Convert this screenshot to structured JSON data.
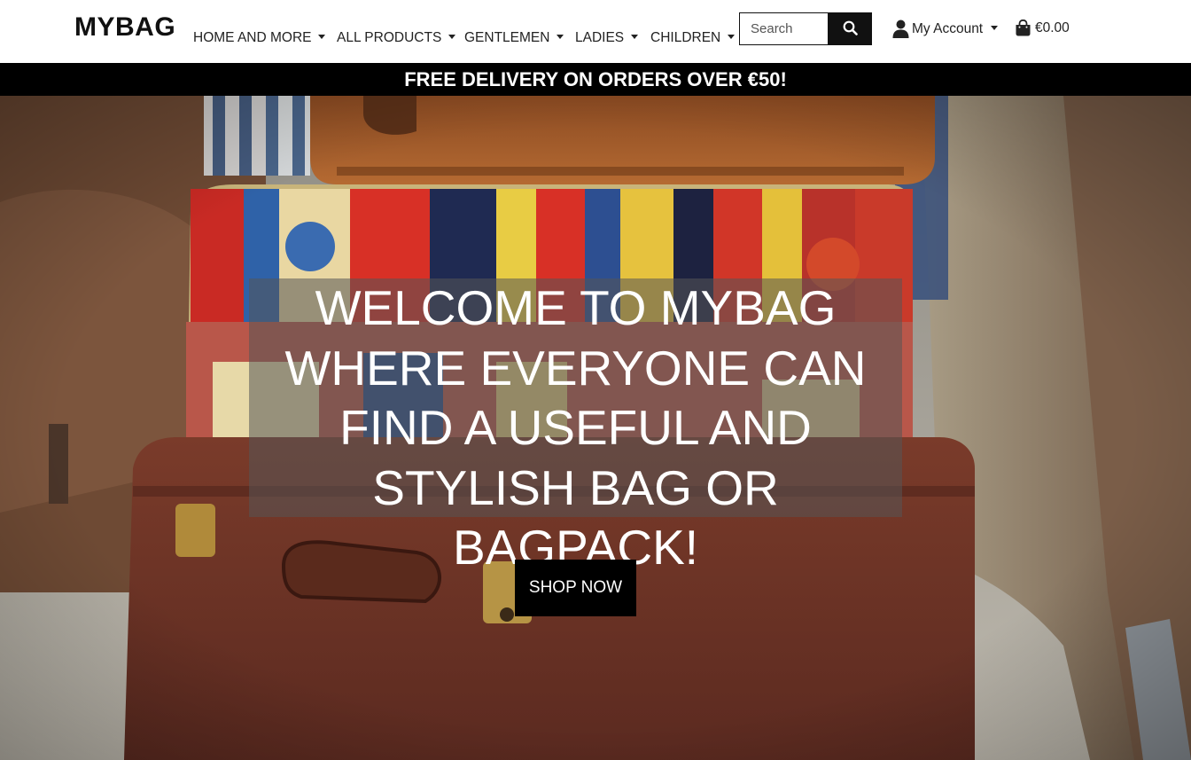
{
  "brand": {
    "logo": "MYBAG"
  },
  "nav": {
    "items": [
      {
        "label": "HOME AND MORE"
      },
      {
        "label": "ALL PRODUCTS"
      },
      {
        "label": "GENTLEMEN"
      },
      {
        "label": "LADIES"
      },
      {
        "label": "CHILDREN"
      }
    ]
  },
  "search": {
    "placeholder": "Search",
    "value": "",
    "button_icon": "search-icon"
  },
  "account": {
    "label": "My Account",
    "icon": "user-icon"
  },
  "cart": {
    "total": "€0.00",
    "icon": "shopping-bag-icon"
  },
  "banner": {
    "text": "FREE DELIVERY ON ORDERS OVER €50!"
  },
  "hero": {
    "title": "Welcome to MyBag where everyone can find a useful and stylish bag or bagpack!",
    "cta_label": "SHOP NOW",
    "background": "stack of vintage suitcases"
  },
  "colors": {
    "navbar_bg": "#ffffff",
    "banner_bg": "#000000",
    "banner_text": "#ffffff",
    "button_bg": "#000000",
    "button_text": "#ffffff",
    "overlay": "#555555"
  }
}
